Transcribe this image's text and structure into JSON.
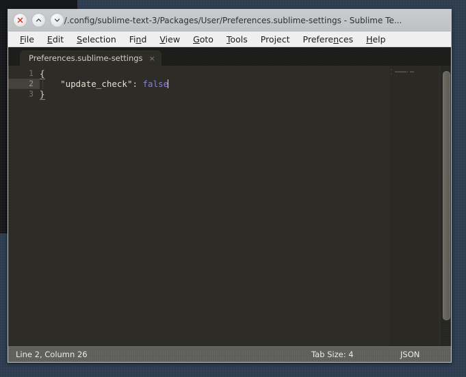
{
  "window": {
    "title": "~/.config/sublime-text-3/Packages/User/Preferences.sublime-settings - Sublime Te...",
    "controls": [
      {
        "name": "close-button",
        "glyph": "x"
      },
      {
        "name": "maximize-button",
        "glyph": "chevron-up"
      },
      {
        "name": "minimize-button",
        "glyph": "chevron-down"
      }
    ]
  },
  "menubar": {
    "items": [
      {
        "pre": "",
        "mn": "F",
        "post": "ile"
      },
      {
        "pre": "",
        "mn": "E",
        "post": "dit"
      },
      {
        "pre": "",
        "mn": "S",
        "post": "election"
      },
      {
        "pre": "Fi",
        "mn": "n",
        "post": "d"
      },
      {
        "pre": "",
        "mn": "V",
        "post": "iew"
      },
      {
        "pre": "",
        "mn": "G",
        "post": "oto"
      },
      {
        "pre": "",
        "mn": "T",
        "post": "ools"
      },
      {
        "pre": "Project",
        "mn": "",
        "post": ""
      },
      {
        "pre": "Prefere",
        "mn": "n",
        "post": "ces"
      },
      {
        "pre": "",
        "mn": "H",
        "post": "elp"
      }
    ]
  },
  "tabbar": {
    "tabs": [
      {
        "label": "Preferences.sublime-settings",
        "close": "×",
        "active": true
      }
    ]
  },
  "editor": {
    "gutter": [
      "1",
      "2",
      "3"
    ],
    "active_line_index": 1,
    "lines": [
      {
        "n": "1",
        "tokens": [
          {
            "t": "brace",
            "v": "{"
          }
        ]
      },
      {
        "n": "2",
        "tokens": [
          {
            "t": "plain",
            "v": "    "
          },
          {
            "t": "string",
            "v": "\"update_check\""
          },
          {
            "t": "punct",
            "v": ":"
          },
          {
            "t": "plain",
            "v": " "
          },
          {
            "t": "const",
            "v": "false"
          },
          {
            "t": "cursor",
            "v": ""
          }
        ]
      },
      {
        "n": "3",
        "tokens": [
          {
            "t": "brace",
            "v": "}"
          }
        ]
      }
    ]
  },
  "statusbar": {
    "caret": "Line 2, Column 26",
    "tab_size": "Tab Size: 4",
    "syntax": "JSON"
  },
  "colors": {
    "desktop": "#2e3e50",
    "editor_bg": "#2d2c27",
    "tabbar_bg": "#1b1b19",
    "statusbar_bg": "#5d5d5a",
    "constant": "#8b7dd8",
    "string": "#e3e1d3",
    "close_x": "#c0392b"
  }
}
